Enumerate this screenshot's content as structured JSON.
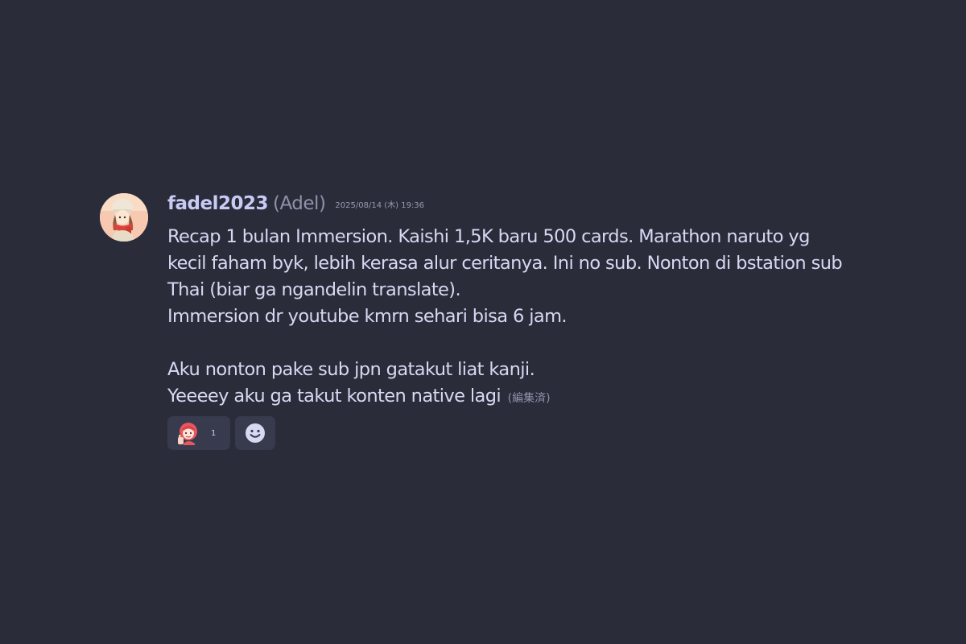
{
  "message": {
    "username": "fadel2023",
    "nickname": "(Adel)",
    "timestamp": "2025/08/14 (木) 19:36",
    "lines": [
      "Recap 1 bulan Immersion. Kaishi 1,5K baru 500 cards. Marathon naruto yg",
      "kecil faham byk, lebih kerasa alur ceritanya. Ini no sub. Nonton di bstation sub",
      "Thai (biar ga ngandelin translate).",
      "Immersion dr youtube kmrn sehari bisa 6 jam.",
      "",
      "Aku nonton pake sub jpn gatakut liat kanji.",
      "Yeeeey aku ga takut konten native lagi"
    ],
    "edited_label": "(編集済)",
    "avatar_icon": "user-avatar-anime-girl-icon"
  },
  "reactions": [
    {
      "icon": "anime-girl-emoji-icon",
      "count": "1"
    }
  ],
  "add_reaction_icon": "smiley-face-icon",
  "colors": {
    "background": "#2a2c3a",
    "username": "#c9cbf5",
    "text": "#d7d9f3",
    "muted": "#8f91aa",
    "reaction_bg": "#383b4d"
  }
}
